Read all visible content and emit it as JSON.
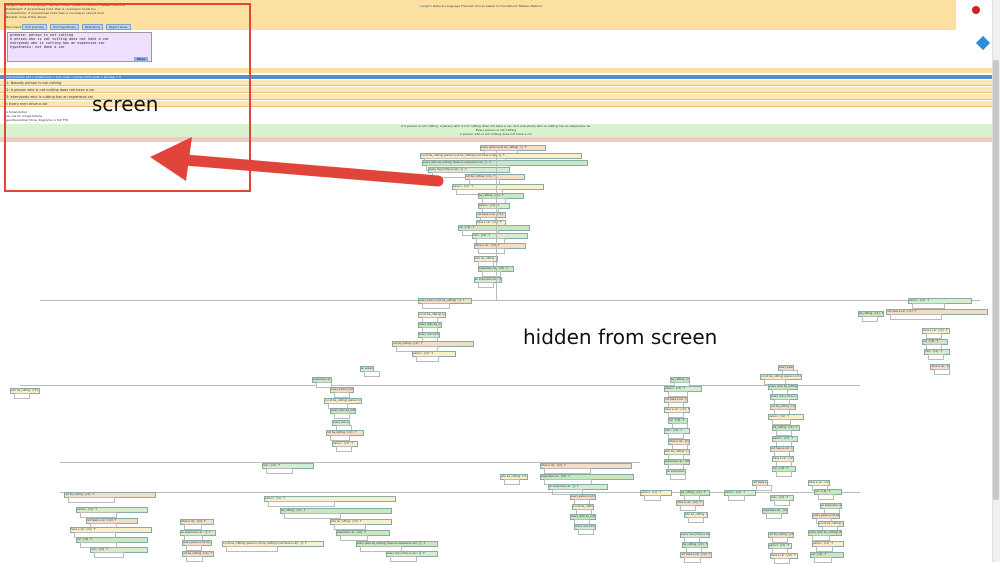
{
  "header": {
    "nav_links": [
      "LangPro",
      "Natural",
      "Language",
      "Theorem",
      "Prover",
      "based on the",
      "Natural",
      "Tableau",
      "Method"
    ],
    "intro_lines": [
      "LangPro Natural Language Theorem Prover (based on Natural Tableau method)",
      "Entailment: if all premises hold, then a conclusion holds too",
      "Contradiction: if all premises hold, then a conclusion cannot hold",
      "Neutral: none of the above"
    ],
    "input_label": "Your input",
    "buttons": [
      "Add premise",
      "Add hypothesis",
      "Reference",
      "Report issue"
    ]
  },
  "editor": {
    "lines": [
      "premise: person is not cutting",
      "A person who is not cutting does not have a car",
      "everybody who is cutting has an expensive car",
      "",
      "hypothesis: not done a car"
    ],
    "submit_label": "Parse"
  },
  "result_bar": "Proof problem (#1): entailment = 1(3) node = parse (3/3) node = be tree = 0",
  "sentences": [
    "P1: Nobody person is not cutting",
    "P2: A person who is not cutting does not have a car",
    "P3: everybody who is cutting has an expensive car",
    "H: Every men drive a car"
  ],
  "options": {
    "option1": "Fix tokenization",
    "option2": "Use rule for single tokens",
    "option3": "Type-theoretical  Show diagrams in full TTS"
  },
  "green_lines": [
    "If a person is not cutting, a person who is not cutting does not have a car, and everybody who is cutting has an expensive car",
    "Every person is not cutting",
    "A person who is not cutting does not have a car",
    "everybody who is cutting has an expensive car",
    "Every men drive a car"
  ],
  "tree": {
    "nodes": [
      "every person (not be_cutting) : [] : T",
      "a (not be_cutting) (person (not be_cutting)) (not have a car) : [] : T",
      "every (who be_cutting) (have an expensive car) : [] : T",
      "every man (drive a car) : [] : F",
      "not be_cutting : [c1] : T",
      "person : [c1] : T",
      "be_cutting : [c1] : F",
      "person : [c2] : T",
      "not have a car : [c2] : T",
      "have a car : [c2] : F",
      "car : [c3] : T",
      "man : [c4] : T",
      "drive a car : [c4] : F",
      "who be_cutting : [c5] : T",
      "expensive car : [c6] : T",
      "an expensive car : [] : T"
    ],
    "closures": [
      "closed",
      "closed",
      "closed",
      "closed",
      "open"
    ]
  },
  "annotations": {
    "screen_label": "screen",
    "hidden_label": "hidden from screen"
  },
  "colors": {
    "arrow": "#e0443a",
    "highlight_box": "#e0443a",
    "header_bg": "#fbe0a0",
    "editor_bg": "#efe0ff",
    "blue_band": "#4d8fd1",
    "green_band": "#d9f3cf"
  }
}
